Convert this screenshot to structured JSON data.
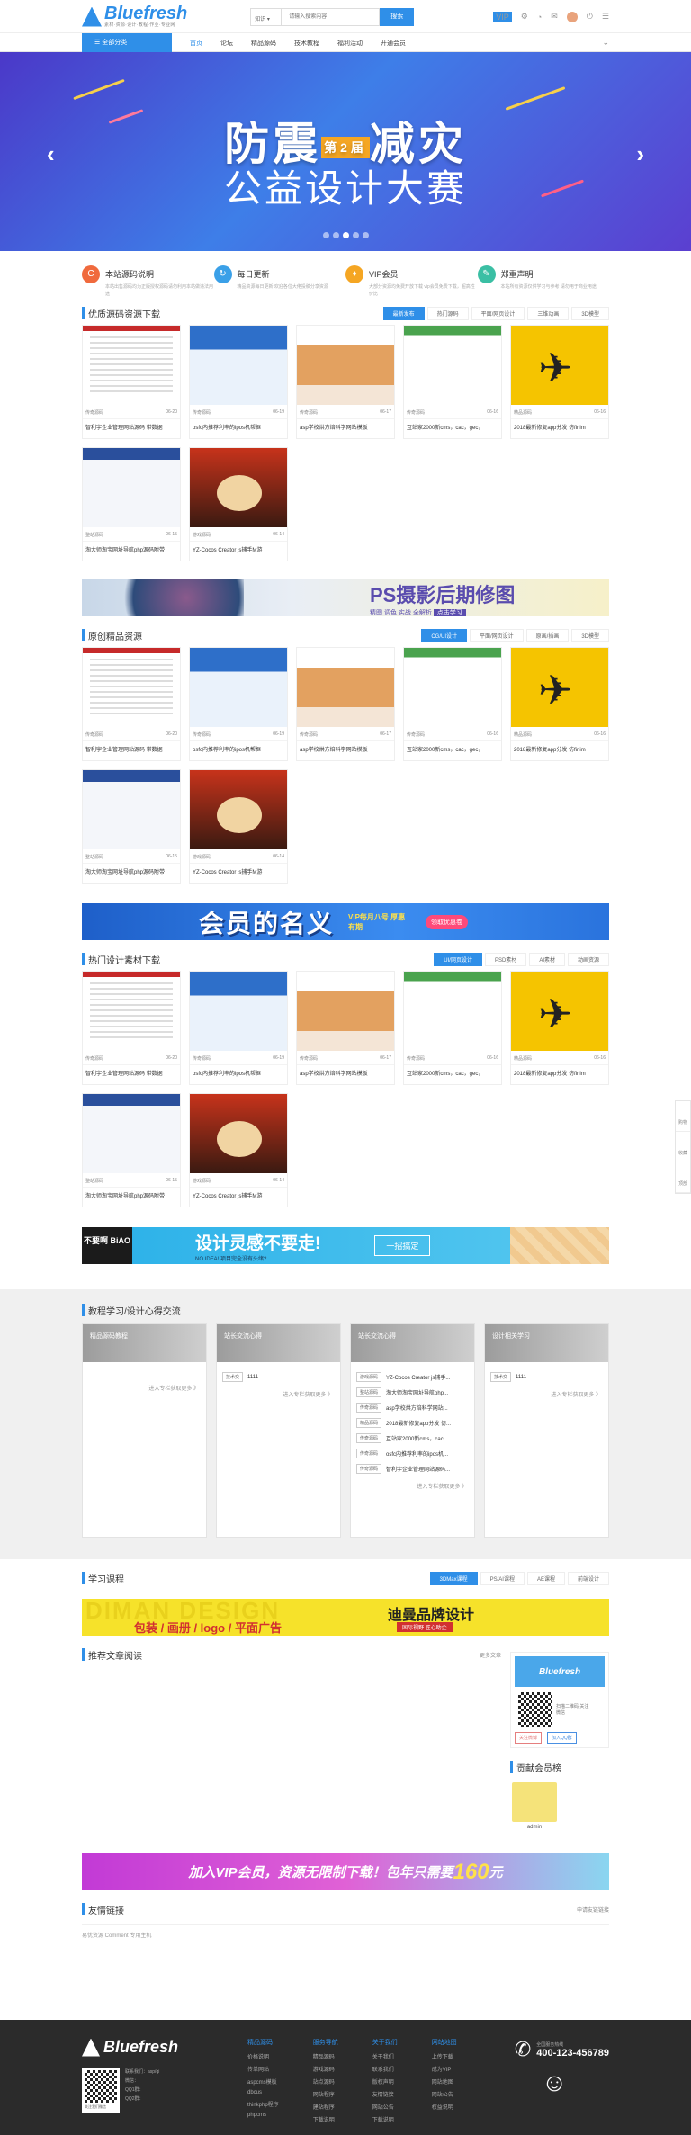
{
  "header": {
    "logo": "Bluefresh",
    "logo_tagline": "素材·资源·设计·教程·作业·专业网",
    "search_category": "知识 ▾",
    "search_placeholder": "请输入搜索内容",
    "search_button": "搜索",
    "vip_badge": "VIP"
  },
  "nav": {
    "category_button": "☰  全部分类",
    "items": [
      "首页",
      "论坛",
      "精品源码",
      "技术教程",
      "福利活动",
      "开通会员"
    ]
  },
  "banner": {
    "title_left": "防震",
    "title_badge": "第2届",
    "title_right": "减灾",
    "subtitle": "公益设计大赛"
  },
  "features": [
    {
      "icon": "C",
      "title": "本站源码说明",
      "desc": "本站出售源码均为正版授权源码请勿利用本站做违法用途",
      "color": "#f06a3d"
    },
    {
      "icon": "↻",
      "title": "每日更新",
      "desc": "精品资源每日更新 欢迎各位大佬投稿分享资源",
      "color": "#3aa0e8"
    },
    {
      "icon": "♦",
      "title": "VIP会员",
      "desc": "大部分资源均免费开放下载 vip会员免费下载，超高性价比",
      "color": "#f5a623"
    },
    {
      "icon": "✎",
      "title": "郑重声明",
      "desc": "本站所有资源仅供学习与参考 请勿用于商业用途",
      "color": "#3bbfa4"
    }
  ],
  "sections": [
    {
      "title": "优质源码资源下载",
      "tabs": [
        "最新发布",
        "热门源码",
        "平面/网页设计",
        "三维动画",
        "3D模型"
      ],
      "active": 0
    },
    {
      "title": "原创精品资源",
      "tabs": [
        "CG/UI设计",
        "平面/网页设计",
        "原画/插画",
        "3D模型"
      ],
      "active": 0
    },
    {
      "title": "热门设计素材下载",
      "tabs": [
        "UI/网页设计",
        "PSD素材",
        "AI素材",
        "动画资源"
      ],
      "active": 0
    }
  ],
  "cards": [
    {
      "cat": "传奇源码",
      "date": "06-20",
      "title": "智利宇企业管理网站源码 带数据",
      "thumb": "th-list"
    },
    {
      "cat": "传奇源码",
      "date": "06-19",
      "title": "osfc内推荐利率的ipos机帮框",
      "thumb": "th-blue"
    },
    {
      "cat": "传奇源码",
      "date": "06-17",
      "title": "asp学校烘方焙科学网站模板",
      "thumb": "th-bread"
    },
    {
      "cat": "传奇源码",
      "date": "06-16",
      "title": "互站家2000新cms，cac，gec，",
      "thumb": "th-green"
    },
    {
      "cat": "精品源码",
      "date": "06-16",
      "title": "2018最新修复app分发 仿fir.im",
      "thumb": "th-plane"
    },
    {
      "cat": "整站源码",
      "date": "06-15",
      "title": "淘大师淘宝网址导航php源码附带",
      "thumb": "th-list2"
    },
    {
      "cat": "游戏源码",
      "date": "06-14",
      "title": "YZ-Cocos Creator js捕手M游",
      "thumb": "th-game"
    }
  ],
  "ads": {
    "ps": "PS摄影后期修图",
    "ps_tags": "精图 调色 实战 全解析",
    "ps_btn": "点击学习",
    "vip": "会员的名义",
    "vip_tag": "VIP每月八号 厚惠有期",
    "vip_btn": "领取优惠卷",
    "idea": "设计灵感不要走!",
    "idea_sub": "NO IDEA! 项目完全没有头绪?",
    "idea_btn": "一招搞定",
    "idea_badge": "不要啊 BiAO",
    "diman_bg": "DIMAN DESIGN",
    "diman": "迪曼品牌设计",
    "diman_sub": "包装 / 画册 / logo / 平面广告",
    "diman_tag": "国际视野 匠心助企",
    "vip2": "加入VIP会员，资源无限制下载！包年只需要",
    "vip2_price": "160",
    "vip2_unit": "元"
  },
  "forum": {
    "title": "教程学习/设计心得交流",
    "cols": [
      {
        "head": "精品源码教程",
        "rows": [],
        "more": "进入专栏获取更多 》"
      },
      {
        "head": "站长交流心得",
        "rows": [
          {
            "tag": "技术交",
            "text": "1111"
          }
        ],
        "more": "进入专栏获取更多 》"
      },
      {
        "head": "站长交流心得",
        "rows": [
          {
            "tag": "游戏源码",
            "text": "YZ-Cocos Creator js捕手..."
          },
          {
            "tag": "整站源码",
            "text": "淘大师淘宝网址导航php..."
          },
          {
            "tag": "传奇源码",
            "text": "asp学校烘方焙科学网站..."
          },
          {
            "tag": "精品源码",
            "text": "2018最新修复app分发 仿..."
          },
          {
            "tag": "传奇源码",
            "text": "互站家2000新cms，cac..."
          },
          {
            "tag": "传奇源码",
            "text": "osfc内推荐利率的ipos机..."
          },
          {
            "tag": "传奇源码",
            "text": "智利宇企业管理网站源码..."
          }
        ],
        "more": "进入专栏获取更多 》"
      },
      {
        "head": "设计相关学习",
        "rows": [
          {
            "tag": "技术交",
            "text": "1111"
          }
        ],
        "more": "进入专栏获取更多 》"
      }
    ]
  },
  "learning": {
    "title": "学习课程",
    "tabs": [
      "3DMax课程",
      "PS/AI课程",
      "AE课程",
      "前端设计"
    ]
  },
  "recommend": {
    "title": "推荐文章阅读",
    "more": "更多文章",
    "side_logo": "Bluefresh",
    "qr_text": "扫描二维码 关注微信",
    "follow": "关注微博",
    "join": "加入QQ群",
    "members_title": "贡献会员榜",
    "member": "admin"
  },
  "links": {
    "title": "友情链接",
    "apply": "申请友链链接",
    "items": "易优资源 Comment 专用主机"
  },
  "footer": {
    "logo": "Bluefresh",
    "contact": "联系我们：asp/qi",
    "contact2": "微信：",
    "contact3": "QQ1群：",
    "contact4": "QQ2群：",
    "qr_label": "关注我们微信",
    "cols": [
      {
        "title": "精品源码",
        "links": [
          "价格说明",
          "传单网站",
          "aspcms模板",
          "dbcus",
          "thinkphp程序",
          "phpcms"
        ]
      },
      {
        "title": "服务导航",
        "links": [
          "精品源码",
          "游戏源码",
          "站点源码",
          "网站程序",
          "建站程序",
          "下载说明"
        ]
      },
      {
        "title": "关于我们",
        "links": [
          "关于我们",
          "联系我们",
          "版权声明",
          "友情链接",
          "网站公告",
          "下载说明"
        ]
      },
      {
        "title": "网站地图",
        "links": [
          "上传下载",
          "成为VIP",
          "网站地图",
          "网站公告",
          "权益说明"
        ]
      }
    ],
    "hotline_label": "全国服务热线",
    "hotline": "400-123-456789"
  },
  "side_tools": [
    "购物",
    "收藏",
    "顶部"
  ],
  "colors": {
    "accent": "#2f8fe8",
    "footer_bg": "#2b2b2b"
  }
}
